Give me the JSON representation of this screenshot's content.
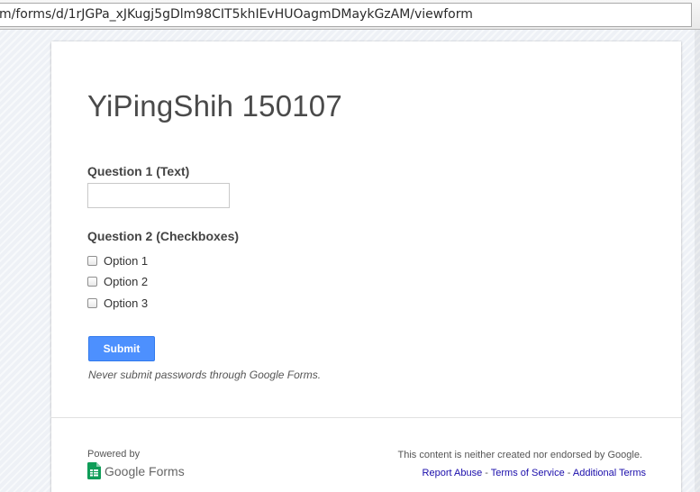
{
  "browser": {
    "url": "m/forms/d/1rJGPa_xJKugj5gDlm98CIT5khIEvHUOagmDMaykGzAM/viewform"
  },
  "form": {
    "title": "YiPingShih 150107",
    "questions": [
      {
        "label": "Question 1 (Text)",
        "type": "text",
        "value": ""
      },
      {
        "label": "Question 2 (Checkboxes)",
        "type": "checkbox",
        "options": [
          {
            "label": "Option 1",
            "checked": false
          },
          {
            "label": "Option 2",
            "checked": false
          },
          {
            "label": "Option 3",
            "checked": false
          }
        ]
      }
    ],
    "submit_label": "Submit",
    "warning": "Never submit passwords through Google Forms."
  },
  "footer": {
    "powered_by": "Powered by",
    "logo_text": "Google Forms",
    "disclaimer": "This content is neither created nor endorsed by Google.",
    "links": [
      "Report Abuse",
      "Terms of Service",
      "Additional Terms"
    ],
    "separator": " - "
  },
  "colors": {
    "submit_bg": "#4d90fe",
    "link": "#1a0dab",
    "sheets_green": "#0f9d58"
  },
  "icons": {
    "logo": "google-sheets-icon"
  }
}
